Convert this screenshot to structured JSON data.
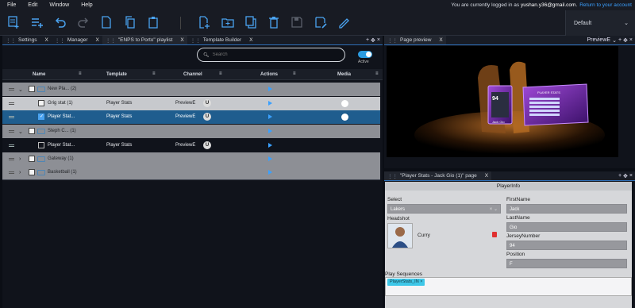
{
  "menu": [
    "File",
    "Edit",
    "Window",
    "Help"
  ],
  "login": {
    "prefix": "You are currently logged in as",
    "user": "yushan.y36@gmail.com.",
    "link": "Return to your account"
  },
  "layout_select": "Default",
  "toolbar_icons": [
    "new-template-icon",
    "add-item-icon",
    "undo-icon",
    "redo-icon",
    "new-file-icon",
    "copy-icon",
    "paste-icon",
    "add-page-icon",
    "add-folder-icon",
    "duplicate-icon",
    "delete-icon",
    "save-icon",
    "save-as-icon",
    "edit-icon"
  ],
  "left_tabs": [
    {
      "label": "Settings",
      "close": "X"
    },
    {
      "label": "Manager",
      "close": "X"
    },
    {
      "label": "\"ENPS to Porto\" playlist",
      "close": "X"
    },
    {
      "label": "Template Builder",
      "close": "X"
    }
  ],
  "search": {
    "placeholder": "Search"
  },
  "toggle_label": "Active",
  "columns": {
    "name": "Name",
    "template": "Template",
    "channel": "Channel",
    "actions": "Actions",
    "media": "Media"
  },
  "rows": [
    {
      "name": "New Pla... (2)",
      "template": "",
      "channel": ""
    },
    {
      "name": "Grig stat (1)",
      "template": "Player Stats",
      "channel": "PreviewE"
    },
    {
      "name": "Player Stat...",
      "template": "Player Stats",
      "channel": "PreviewE"
    },
    {
      "name": "Steph C... (1)",
      "template": "",
      "channel": ""
    },
    {
      "name": "Player Stat...",
      "template": "Player Stats",
      "channel": "PreviewE"
    },
    {
      "name": "Gateway (1)",
      "template": "",
      "channel": ""
    },
    {
      "name": "Basketball (1)",
      "template": "",
      "channel": ""
    }
  ],
  "preview_panel": {
    "tab": "Page preview",
    "close": "X",
    "select": "PreviewE"
  },
  "preview_card": {
    "number": "94",
    "name": "Jack Gio",
    "stats_title": "PLAYER STATS"
  },
  "page_panel": {
    "tab": "\"Player Stats - Jack Gio (1)\" page",
    "close": "X",
    "form_title": "PlayerInfo",
    "select_label": "Select",
    "select_value": "Lakers",
    "headshot_label": "Headshot",
    "headshot_name": "Curry",
    "firstname_label": "FirstName",
    "firstname": "Jack",
    "lastname_label": "LastName",
    "lastname": "Gio",
    "jersey_label": "JerseyNumber",
    "jersey": "94",
    "position_label": "Position",
    "position": "F",
    "sequences_label": "Play Sequences",
    "sequence_tag": "PlayerStats_IN"
  }
}
